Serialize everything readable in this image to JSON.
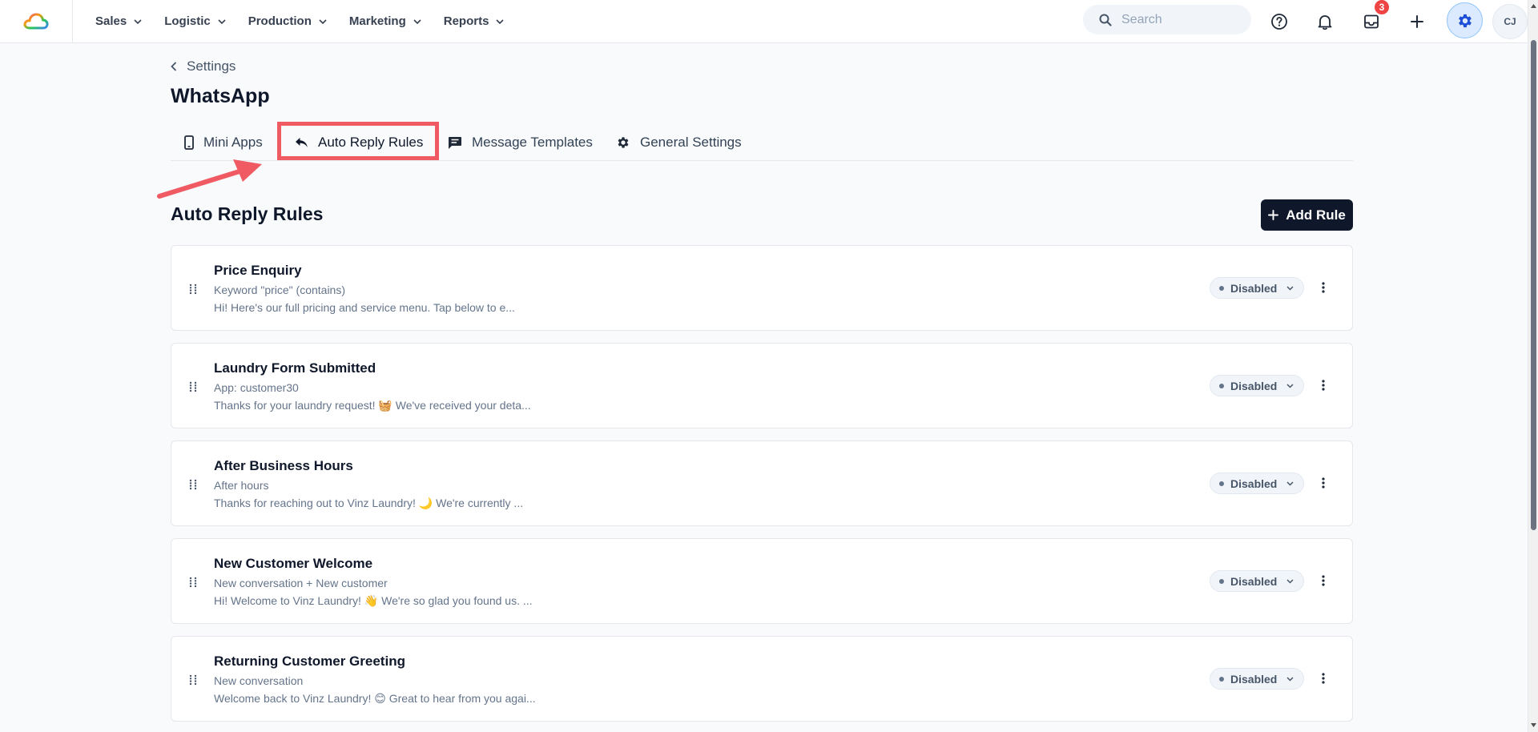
{
  "nav": {
    "items": [
      {
        "label": "Sales"
      },
      {
        "label": "Logistic"
      },
      {
        "label": "Production"
      },
      {
        "label": "Marketing"
      },
      {
        "label": "Reports"
      }
    ],
    "search_placeholder": "Search",
    "inbox_badge": "3",
    "avatar_initials": "CJ"
  },
  "breadcrumb": {
    "label": "Settings"
  },
  "page_title": "WhatsApp",
  "tabs": [
    {
      "label": "Mini Apps",
      "icon": "phone-icon"
    },
    {
      "label": "Auto Reply Rules",
      "icon": "reply-icon",
      "active": true
    },
    {
      "label": "Message Templates",
      "icon": "message-icon"
    },
    {
      "label": "General Settings",
      "icon": "gear-icon"
    }
  ],
  "section": {
    "title": "Auto Reply Rules",
    "add_label": "Add Rule"
  },
  "rules": [
    {
      "title": "Price Enquiry",
      "trigger": "Keyword \"price\" (contains)",
      "preview": "Hi! Here's our full pricing and service menu. Tap below to e...",
      "status": "Disabled"
    },
    {
      "title": "Laundry Form Submitted",
      "trigger": "App: customer30",
      "preview": "Thanks for your laundry request! 🧺 We've received your deta...",
      "status": "Disabled"
    },
    {
      "title": "After Business Hours",
      "trigger": "After hours",
      "preview": "Thanks for reaching out to Vinz Laundry! 🌙 We're currently ...",
      "status": "Disabled"
    },
    {
      "title": "New Customer Welcome",
      "trigger": "New conversation + New customer",
      "preview": "Hi! Welcome to Vinz Laundry! 👋 We're so glad you found us. ...",
      "status": "Disabled"
    },
    {
      "title": "Returning Customer Greeting",
      "trigger": "New conversation",
      "preview": "Welcome back to Vinz Laundry! 😊 Great to hear from you agai...",
      "status": "Disabled"
    }
  ],
  "colors": {
    "accent": "#0f172a",
    "highlight": "#f05a62",
    "badge": "#ef4444"
  }
}
